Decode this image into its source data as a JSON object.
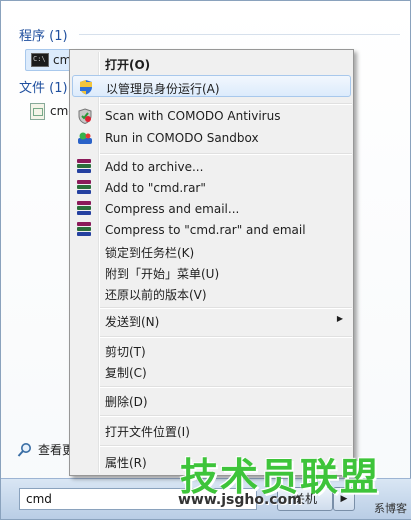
{
  "results": {
    "programs_header": "程序 (1)",
    "files_header": "文件 (1)",
    "program_item": "cmd",
    "file_item": "cmd",
    "see_more": "查看更"
  },
  "search": {
    "value": "cmd",
    "shutdown_label": "关机"
  },
  "context_menu": {
    "items": [
      {
        "label": "打开(O)"
      },
      {
        "label": "以管理员身份运行(A)"
      },
      {
        "label": "Scan with COMODO Antivirus"
      },
      {
        "label": "Run in COMODO Sandbox"
      },
      {
        "label": "Add to archive..."
      },
      {
        "label": "Add to \"cmd.rar\""
      },
      {
        "label": "Compress and email..."
      },
      {
        "label": "Compress to \"cmd.rar\" and email"
      },
      {
        "label": "锁定到任务栏(K)"
      },
      {
        "label": "附到「开始」菜单(U)"
      },
      {
        "label": "还原以前的版本(V)"
      },
      {
        "label": "发送到(N)"
      },
      {
        "label": "剪切(T)"
      },
      {
        "label": "复制(C)"
      },
      {
        "label": "删除(D)"
      },
      {
        "label": "打开文件位置(I)"
      },
      {
        "label": "属性(R)"
      }
    ]
  },
  "watermark": {
    "title": "技术员联盟",
    "url": "www.jsgho.com",
    "tail": "系博客"
  },
  "icons": {
    "uac": "uac-shield-icon",
    "comodo_scan": "comodo-scan-icon",
    "comodo_sandbox": "comodo-sandbox-icon",
    "rar": "winrar-icon",
    "submenu": "chevron-right-icon",
    "search": "magnifier-icon"
  },
  "colors": {
    "group_header": "#1f4f9e",
    "highlight_bg": "#dcebfc",
    "highlight_border": "#a8c8ec",
    "watermark_green": "#3ec43a"
  }
}
